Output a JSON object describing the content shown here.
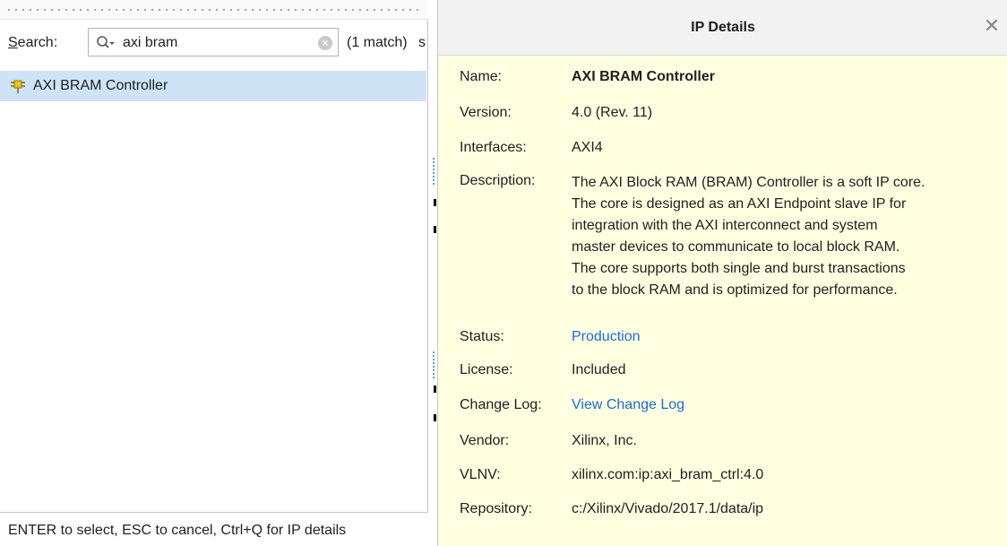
{
  "search_panel": {
    "search_label": "Search:",
    "search_value": "axi bram",
    "match_count": "(1 match)",
    "match_clip": "s",
    "results": [
      {
        "label": "AXI BRAM Controller",
        "icon": "ip-core-icon"
      }
    ],
    "help_text": "ENTER to select, ESC to cancel, Ctrl+Q for IP details"
  },
  "details": {
    "title": "IP Details",
    "labels": {
      "name": "Name:",
      "version": "Version:",
      "interfaces": "Interfaces:",
      "description": "Description:",
      "status": "Status:",
      "license": "License:",
      "change_log": "Change Log:",
      "vendor": "Vendor:",
      "vlnv": "VLNV:",
      "repository": "Repository:"
    },
    "name": "AXI BRAM Controller",
    "version": "4.0 (Rev. 11)",
    "interfaces": "AXI4",
    "description_lines": [
      "The AXI Block RAM (BRAM) Controller is a soft IP core.",
      "The core is designed as an AXI Endpoint slave IP for",
      "integration with the AXI interconnect and system",
      "master devices to communicate to local block RAM.",
      "The core supports both single and burst transactions",
      "to the block RAM and is optimized for performance."
    ],
    "status": "Production",
    "license": "Included",
    "change_log": "View Change Log",
    "vendor": "Xilinx, Inc.",
    "vlnv": "xilinx.com:ip:axi_bram_ctrl:4.0",
    "repository": "c:/Xilinx/Vivado/2017.1/data/ip"
  },
  "colors": {
    "selection": "#cfe3f7",
    "tooltip_bg": "#ffffe1",
    "link": "#1a6bd8"
  }
}
